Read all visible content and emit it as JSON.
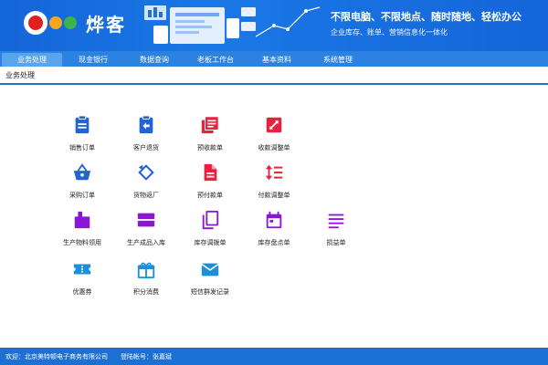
{
  "header": {
    "brand": "烨客",
    "slogan": "不限电脑、不限地点、随时随地、轻松办公",
    "subslogan": "企业库存、账单、营销信息化一体化"
  },
  "nav": {
    "tabs": [
      {
        "label": "业务处理",
        "active": true
      },
      {
        "label": "现金银行",
        "active": false
      },
      {
        "label": "数据查询",
        "active": false
      },
      {
        "label": "老板工作台",
        "active": false
      },
      {
        "label": "基本资料",
        "active": false
      },
      {
        "label": "系统管理",
        "active": false
      }
    ]
  },
  "breadcrumb": "业务处理",
  "tiles": [
    {
      "label": "销售订单",
      "icon": "clipboard-icon",
      "color": "#2463d6"
    },
    {
      "label": "客户退货",
      "icon": "return-arrow-icon",
      "color": "#2463d6"
    },
    {
      "label": "预收款单",
      "icon": "document-stack-icon",
      "color": "#e8213f"
    },
    {
      "label": "收款调整单",
      "icon": "edit-square-icon",
      "color": "#e8213f"
    },
    {
      "label": "采购订单",
      "icon": "basket-icon",
      "color": "#2463d6"
    },
    {
      "label": "货物返厂",
      "icon": "rotate-icon",
      "color": "#2463d6"
    },
    {
      "label": "预付款单",
      "icon": "file-icon",
      "color": "#e8213f"
    },
    {
      "label": "付款调整单",
      "icon": "sort-list-icon",
      "color": "#e8213f"
    },
    {
      "label": "生产物料领用",
      "icon": "pick-material-icon",
      "color": "#8b16d6"
    },
    {
      "label": "生产成品入库",
      "icon": "storage-icon",
      "color": "#8b16d6"
    },
    {
      "label": "库存调拨单",
      "icon": "copy-icon",
      "color": "#8b16d6"
    },
    {
      "label": "库存盘点单",
      "icon": "calendar-icon",
      "color": "#8b16d6"
    },
    {
      "label": "损益单",
      "icon": "lines-icon",
      "color": "#8b16d6"
    },
    {
      "label": "优惠券",
      "icon": "ticket-icon",
      "color": "#1b8fdc"
    },
    {
      "label": "积分消费",
      "icon": "gift-icon",
      "color": "#1b8fdc"
    },
    {
      "label": "短信群发记录",
      "icon": "mail-icon",
      "color": "#1b8fdc"
    }
  ],
  "footer": {
    "welcome": "欢迎：北京美特顿电子商务有限公司",
    "account": "登陆帐号：张嘉斌"
  }
}
